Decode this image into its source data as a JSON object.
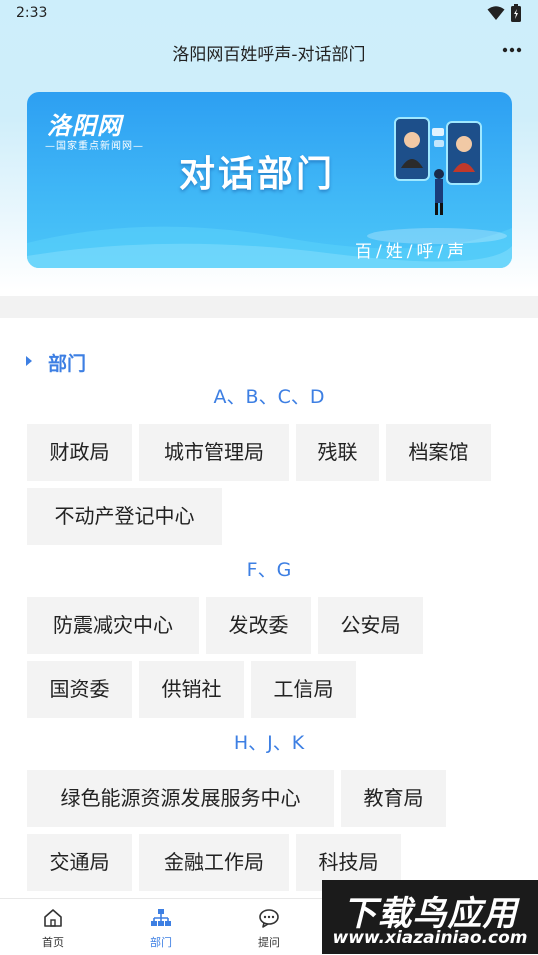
{
  "status_bar": {
    "time": "2:33"
  },
  "header": {
    "title": "洛阳网百姓呼声-对话部门",
    "more": "⋮"
  },
  "banner": {
    "logo": "洛阳网",
    "logo_sub": "—国家重点新闻网—",
    "title": "对话部门",
    "slogan": "百/姓/呼/声"
  },
  "section": {
    "title": "部门"
  },
  "groups": [
    {
      "label": "A、B、C、D",
      "items": [
        "财政局",
        "城市管理局",
        "残联",
        "档案馆",
        "不动产登记中心"
      ]
    },
    {
      "label": "F、G",
      "items": [
        "防震减灾中心",
        "发改委",
        "公安局",
        "国资委",
        "供销社",
        "工信局"
      ]
    },
    {
      "label": "H、J、K",
      "items": [
        "绿色能源资源发展服务中心",
        "教育局",
        "交通局",
        "金融工作局",
        "科技局"
      ]
    }
  ],
  "bottom_nav": [
    {
      "label": "首页",
      "icon": "home-icon",
      "active": false
    },
    {
      "label": "部门",
      "icon": "org-chart-icon",
      "active": true
    },
    {
      "label": "提问",
      "icon": "chat-bubble-icon",
      "active": false
    }
  ],
  "watermark": {
    "text": "下载鸟应用",
    "url": "www.xiazainiao.com"
  },
  "colors": {
    "accent": "#3d7fe3",
    "chip_bg": "#f3f3f3",
    "banner": "#35aaf5"
  }
}
